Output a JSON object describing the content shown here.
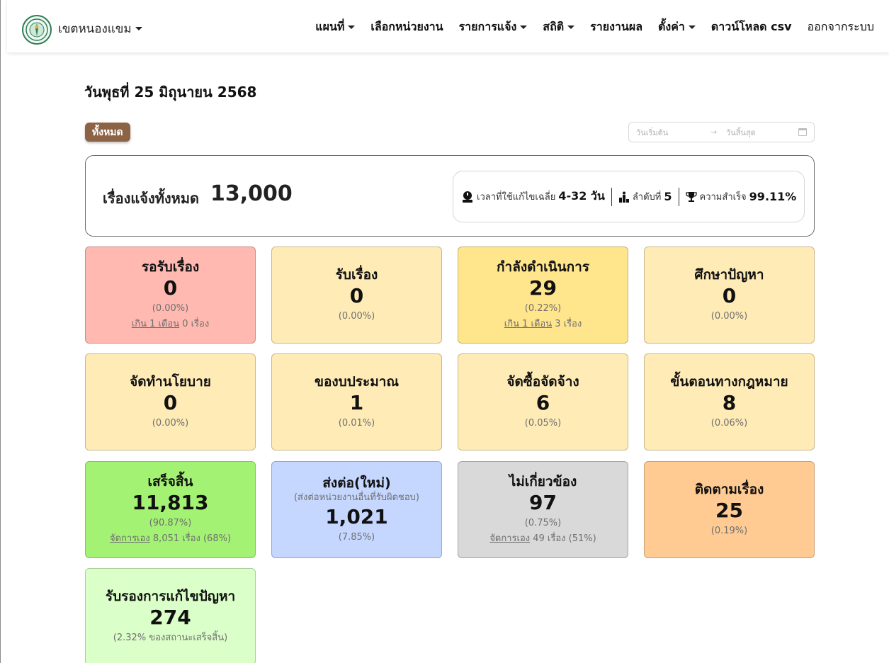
{
  "nav": {
    "brand": "เขตหนองแขม",
    "menu": [
      {
        "label": "แผนที่",
        "dropdown": true
      },
      {
        "label": "เลือกหน่วยงาน",
        "dropdown": false
      },
      {
        "label": "รายการแจ้ง",
        "dropdown": true
      },
      {
        "label": "สถิติ",
        "dropdown": true
      },
      {
        "label": "รายงานผล",
        "dropdown": false
      },
      {
        "label": "ตั้งค่า",
        "dropdown": true
      },
      {
        "label": "ดาวน์โหลด csv",
        "dropdown": false
      },
      {
        "label": "ออกจากระบบ",
        "dropdown": false
      }
    ]
  },
  "page": {
    "date_title": "วันพุธที่ 25 มิถุนายน 2568",
    "filter_all": "ทั้งหมด",
    "date_range": {
      "start_placeholder": "วันเริ่มต้น",
      "arrow": "→",
      "end_placeholder": "วันสิ้นสุด"
    }
  },
  "summary": {
    "label": "เรื่องแจ้งทั้งหมด",
    "total": "13,000",
    "avg_time_label": "เวลาที่ใช้แก้ไขเฉลี่ย",
    "avg_time_value": "4-32 วัน",
    "rank_label": "ลำดับที่",
    "rank_value": "5",
    "success_label": "ความสำเร็จ",
    "success_value": "99.11%"
  },
  "cards": {
    "c1": {
      "title": "รอรับเรื่อง",
      "count": "0",
      "pct": "(0.00%)",
      "note_link": "เกิน 1 เดือน",
      "note_rest": " 0 เรื่อง",
      "color": "#ffb9b1"
    },
    "c2": {
      "title": "รับเรื่อง",
      "count": "0",
      "pct": "(0.00%)",
      "color": "#ffebb6"
    },
    "c3": {
      "title": "กำลังดำเนินการ",
      "count": "29",
      "pct": "(0.22%)",
      "note_link": "เกิน 1 เดือน",
      "note_rest": " 3 เรื่อง",
      "color": "#ffe58c"
    },
    "c4": {
      "title": "ศึกษาปัญหา",
      "count": "0",
      "pct": "(0.00%)",
      "color": "#ffebb6"
    },
    "c5": {
      "title": "จัดทำนโยบาย",
      "count": "0",
      "pct": "(0.00%)",
      "color": "#ffebb6"
    },
    "c6": {
      "title": "ของบประมาณ",
      "count": "1",
      "pct": "(0.01%)",
      "color": "#ffebb6"
    },
    "c7": {
      "title": "จัดซื้อจัดจ้าง",
      "count": "6",
      "pct": "(0.05%)",
      "color": "#ffebb6"
    },
    "c8": {
      "title": "ขั้นตอนทางกฎหมาย",
      "count": "8",
      "pct": "(0.06%)",
      "color": "#ffebb6"
    },
    "c9": {
      "title": "เสร็จสิ้น",
      "count": "11,813",
      "pct": "(90.87%)",
      "note_link": "จัดการเอง",
      "note_rest": " 8,051 เรื่อง (68%)",
      "color": "#a4f274"
    },
    "c10": {
      "title": "ส่งต่อ(ใหม่)",
      "subtitle": "(ส่งต่อหน่วยงานอื่นที่รับผิดชอบ)",
      "count": "1,021",
      "pct": "(7.85%)",
      "color": "#c5d7ff"
    },
    "c11": {
      "title": "ไม่เกี่ยวข้อง",
      "count": "97",
      "pct": "(0.75%)",
      "note_link": "จัดการเอง",
      "note_rest": " 49 เรื่อง (51%)",
      "color": "#d9d9d9"
    },
    "c12": {
      "title": "ติดตามเรื่อง",
      "count": "25",
      "pct": "(0.19%)",
      "color": "#ffcb92"
    },
    "c13": {
      "title": "รับรองการแก้ไขปัญหา",
      "count": "274",
      "pct": "(2.32% ของสถานะเสร็จสิ้น)",
      "color": "#dbffc9"
    }
  }
}
